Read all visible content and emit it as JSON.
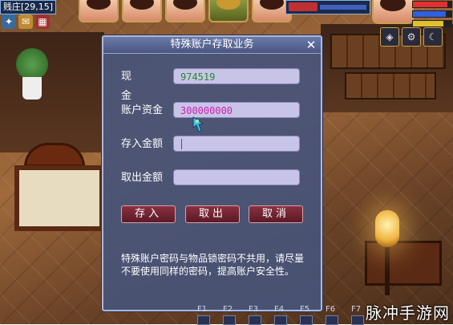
{
  "hud": {
    "map_label": "贱庄[29,15]",
    "stat_bar_fills": [
      0.9,
      0.85,
      0.8
    ]
  },
  "dialog": {
    "title": "特殊账户存取业务",
    "close_icon": "close-icon",
    "cash_label": "现金",
    "cash_value": "974519",
    "account_label": "账户资金",
    "account_value": "300000000",
    "deposit_label": "存入金额",
    "deposit_value": "",
    "withdraw_label": "取出金额",
    "withdraw_value": "",
    "deposit_button": "存入",
    "withdraw_button": "取出",
    "cancel_button": "取消",
    "note": "特殊账户密码与物品锁密码不共用，请尽量不要使用同样的密码，提高账户安全性。"
  },
  "hotkeys": [
    "F1",
    "F2",
    "F3",
    "F4",
    "F5",
    "F6",
    "F7"
  ],
  "watermark": "脉冲手游网",
  "colors": {
    "dialog_bg": "#485478",
    "field_bg": "#c8c4e8",
    "cash_text": "#2a8a2a",
    "account_text": "#d020b0",
    "button_bg": "#8a3040"
  }
}
